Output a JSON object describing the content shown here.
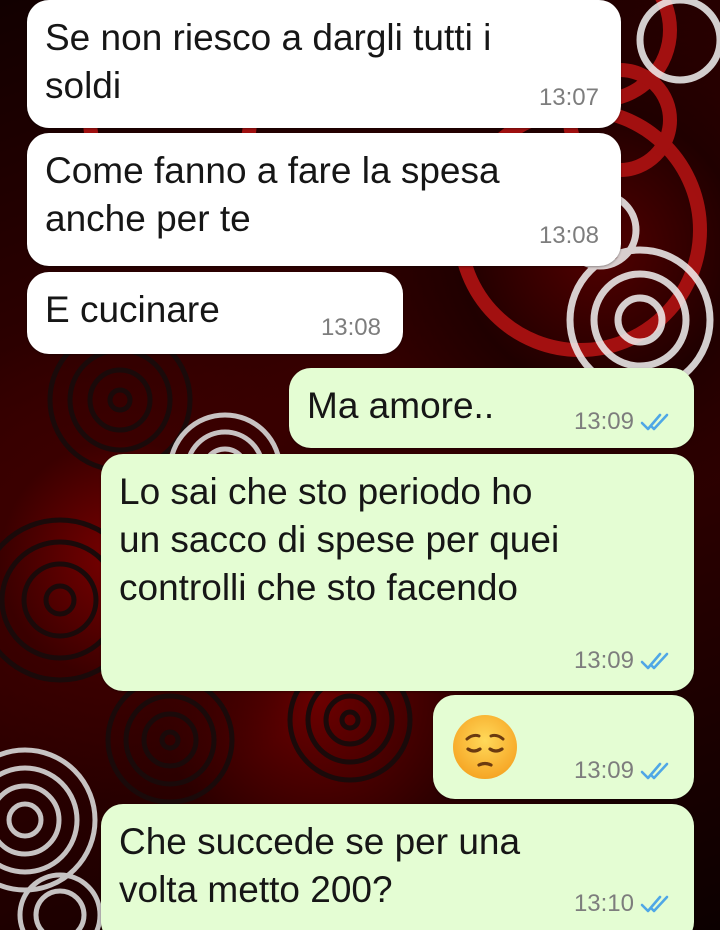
{
  "messages": [
    {
      "text": "Se non riesco a dargli tutti i\nsoldi",
      "time": "13:07"
    },
    {
      "text": "Come fanno a fare la spesa\nanche per te",
      "time": "13:08"
    },
    {
      "text": "E cucinare",
      "time": "13:08"
    },
    {
      "text": "Ma amore..",
      "time": "13:09",
      "status": "read-double-check"
    },
    {
      "text": "Lo sai che sto periodo ho\nun sacco di spese per quei\ncontrolli che sto facendo",
      "time": "13:09",
      "status": "read-double-check"
    },
    {
      "emoji": "pensive-face",
      "time": "13:09",
      "status": "read-double-check"
    },
    {
      "text": "Che succede se per una\nvolta metto 200?",
      "time": "13:10",
      "status": "read-double-check"
    }
  ],
  "colors": {
    "incoming_bubble": "#ffffff",
    "outgoing_bubble": "#e4fdd3",
    "read_tick": "#4fa7e6",
    "timestamp": "#7d7d7d"
  }
}
